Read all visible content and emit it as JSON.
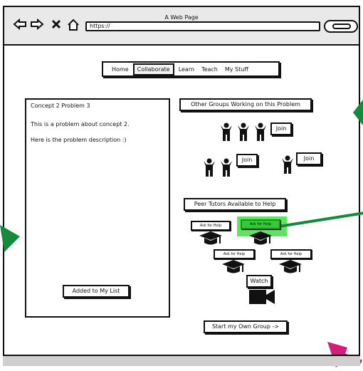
{
  "window": {
    "title": "A Web Page",
    "url": "https://"
  },
  "nav": {
    "tabs": [
      {
        "label": "Home"
      },
      {
        "label": "Collaborate"
      },
      {
        "label": "Learn"
      },
      {
        "label": "Teach"
      },
      {
        "label": "My Stuff"
      }
    ],
    "active_tab": "Collaborate"
  },
  "problem": {
    "title": "Concept 2 Problem 3",
    "desc1": "This is a problem about concept 2.",
    "desc2": "Here is the problem description :)",
    "added_label": "Added to My List"
  },
  "groups": {
    "header": "Other Groups Working on this Problem",
    "join_label": "Join"
  },
  "tutors": {
    "header": "Peer Tutors Available to Help",
    "ask_label": "Ask for Help",
    "watch_label": "Watch",
    "highlight_color": "#34cc34"
  },
  "start_group_label": "Start my Own Group ->",
  "colors": {
    "annotation_green": "#138a3c",
    "annotation_pink": "#d41c78"
  }
}
